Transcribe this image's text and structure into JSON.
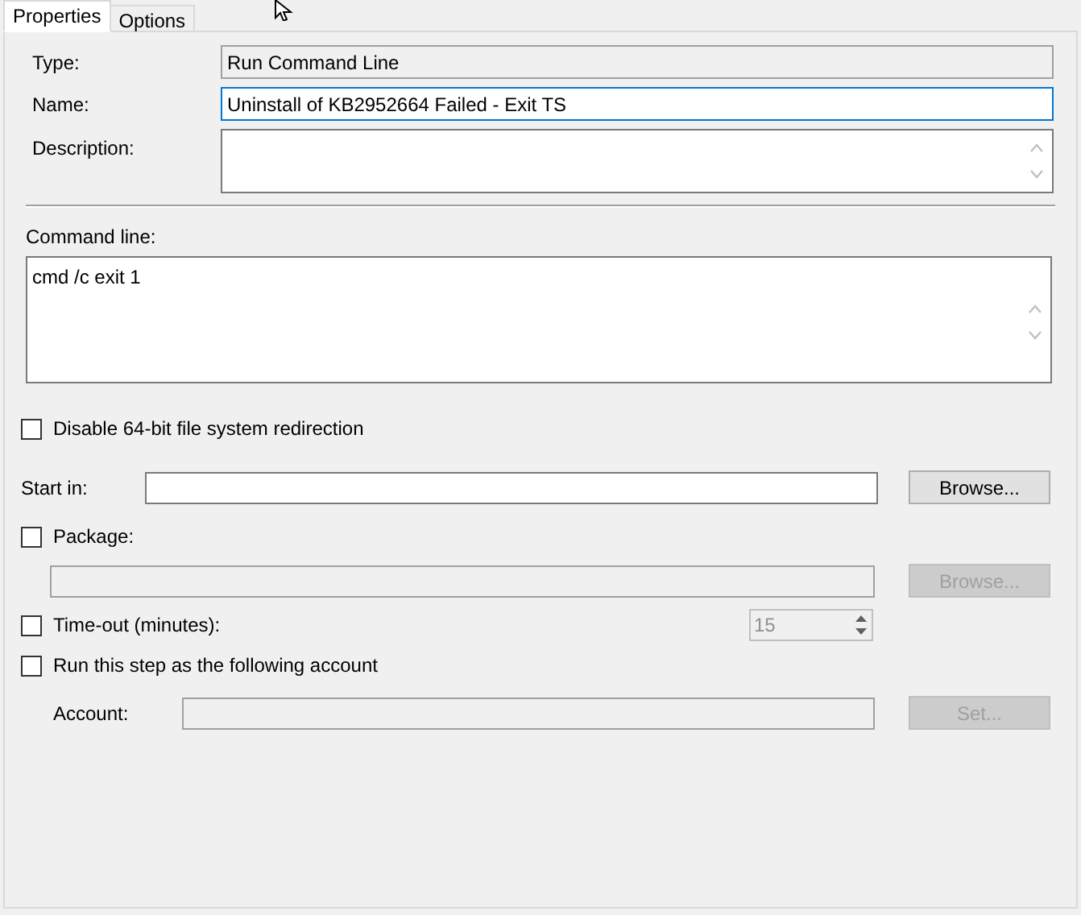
{
  "tabs": [
    {
      "label": "Properties",
      "selected": true
    },
    {
      "label": "Options",
      "selected": false
    }
  ],
  "type": {
    "label": "Type:",
    "value": "Run Command Line",
    "disabled": true
  },
  "name": {
    "label": "Name:",
    "value": "Uninstall of KB2952664 Failed - Exit TS",
    "focused": true
  },
  "description": {
    "label": "Description:"
  },
  "command_line": {
    "label": "Command line:",
    "value": "cmd /c exit 1"
  },
  "disable_redirection": {
    "label": "Disable 64-bit file system redirection",
    "checked": false
  },
  "start_in": {
    "label": "Start in:",
    "button": "Browse...",
    "disabled": false
  },
  "package": {
    "label": "Package:",
    "checked": false,
    "button": "Browse...",
    "disabled": true
  },
  "timeout": {
    "label": "Time-out (minutes):",
    "checked": false,
    "value": "15",
    "disabled": true
  },
  "run_as": {
    "label": "Run this step as the following account",
    "checked": false
  },
  "account": {
    "label": "Account:",
    "button": "Set...",
    "disabled": true
  }
}
